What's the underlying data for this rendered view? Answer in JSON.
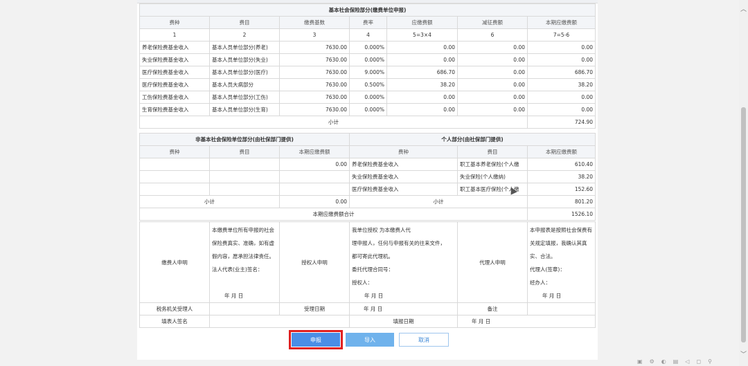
{
  "basic": {
    "title": "基本社会保险部分(缴费单位申报)",
    "headers": [
      "费种",
      "费目",
      "缴费基数",
      "费率",
      "应缴费额",
      "减征费额",
      "本期应缴费额"
    ],
    "index_row": [
      "1",
      "2",
      "3",
      "4",
      "5=3×4",
      "6",
      "7=5-6"
    ],
    "rows": [
      [
        "养老保险费基金收入",
        "基本人员单位部分(养老)",
        "7630.00",
        "0.000%",
        "0.00",
        "0.00",
        "0.00"
      ],
      [
        "失业保险费基金收入",
        "基本人员单位部分(失业)",
        "7630.00",
        "0.000%",
        "0.00",
        "0.00",
        "0.00"
      ],
      [
        "医疗保险费基金收入",
        "基本人员单位部分(医疗)",
        "7630.00",
        "9.000%",
        "686.70",
        "0.00",
        "686.70"
      ],
      [
        "医疗保险费基金收入",
        "基本人员大病部分",
        "7630.00",
        "0.500%",
        "38.20",
        "0.00",
        "38.20"
      ],
      [
        "工伤保险费基金收入",
        "基本人员单位部分(工伤)",
        "7630.00",
        "0.000%",
        "0.00",
        "0.00",
        "0.00"
      ],
      [
        "生育保险费基金收入",
        "基本人员单位部分(生育)",
        "7630.00",
        "0.000%",
        "0.00",
        "0.00",
        "0.00"
      ]
    ],
    "subtotal_label": "小计",
    "subtotal_value": "724.90"
  },
  "nonbasic": {
    "title": "非基本社会保险单位部分(由社保部门提供)",
    "headers": [
      "费种",
      "费目",
      "本期应缴费额"
    ],
    "rows": [
      [
        "",
        "",
        "0.00"
      ],
      [
        "",
        "",
        ""
      ],
      [
        "",
        "",
        ""
      ]
    ],
    "subtotal_label": "小计",
    "subtotal_value": "0.00"
  },
  "personal": {
    "title": "个人部分(由社保部门提供)",
    "headers": [
      "费种",
      "费目",
      "本期应缴费额"
    ],
    "rows": [
      [
        "养老保险费基金收入",
        "职工基本养老保险(个人缴",
        "610.40"
      ],
      [
        "失业保险费基金收入",
        "失业保险(个人缴纳)",
        "38.20"
      ],
      [
        "医疗保险费基金收入",
        "职工基本医疗保险(个人缴",
        "152.60"
      ]
    ],
    "subtotal_label": "小计",
    "subtotal_value": "801.20"
  },
  "total": {
    "label": "本期应缴费额合计",
    "value": "1526.10"
  },
  "declaration": {
    "payer_label": "缴费人申明",
    "payer_text": [
      "本缴费单位所有申报的社会",
      "保险费真实、准确，如有虚",
      "假内容，愿承担法律责任。",
      "法人代表(业主)签名：",
      "",
      "年  月  日"
    ],
    "auth_label": "授权人申明",
    "auth_text": [
      "我单位授权              为本缴费人代",
      "理申报人，任何与申报有关的往来文件，",
      "都可寄此代理机。",
      "委托代理合同号：",
      "授权人：",
      "年  月  日"
    ],
    "agent_label": "代理人申明",
    "agent_text": [
      "本申报表是按照社会保费有",
      "关规定填报，我确认其真",
      "实、合法。",
      "代理人(签章)：",
      "经办人：",
      "年  月  日"
    ]
  },
  "footer_rows": {
    "tax_officer_label": "税务机关受理人",
    "accept_date_label": "受理日期",
    "accept_date_value": "年  月  日",
    "note_label": "备注",
    "filler_sign_label": "填表人签名",
    "fill_date_label": "填报日期",
    "fill_date_value": "年  月  日"
  },
  "buttons": {
    "submit": "申报",
    "import": "导入",
    "cancel": "取消"
  },
  "scrollbar": {
    "up": "︿",
    "down": "﹀"
  },
  "statusbar_icons": [
    "▣",
    "⚙",
    "◐",
    "▤",
    "◁",
    "◻",
    "⚲"
  ]
}
